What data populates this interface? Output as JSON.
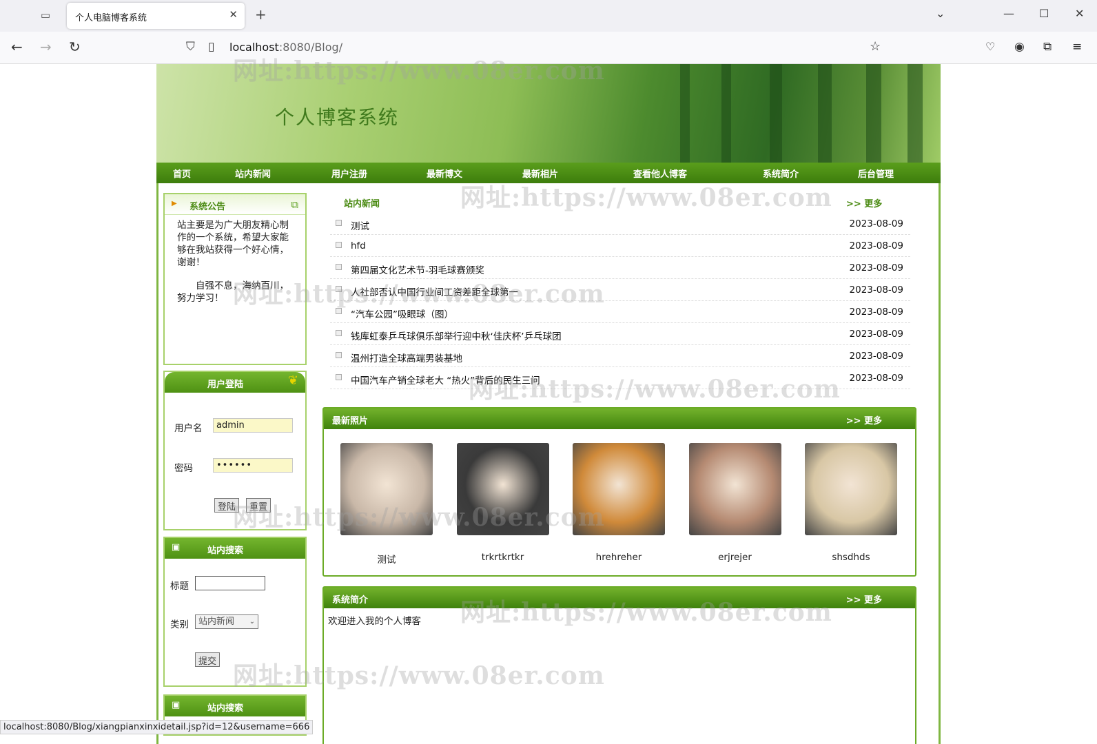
{
  "browser": {
    "tab_title": "个人电脑博客系统",
    "url_host": "localhost",
    "url_rest": ":8080/Blog/",
    "status_url": "localhost:8080/Blog/xiangpianxinxidetail.jsp?id=12&username=666"
  },
  "site": {
    "title": "个人博客系统",
    "menu": [
      "首页",
      "站内新闻",
      "用户注册",
      "最新博文",
      "最新相片",
      "查看他人博客",
      "系统简介",
      "后台管理"
    ]
  },
  "notice": {
    "title": "系统公告",
    "paragraph1": "站主要是为广大朋友精心制作的一个系统，希望大家能够在我站获得一个好心情，谢谢！",
    "paragraph2": "自强不息，海纳百川，努力学习！"
  },
  "login": {
    "title": "用户登陆",
    "username_label": "用户名",
    "username_value": "admin",
    "password_label": "密码",
    "password_value": "••••••",
    "login_button": "登陆",
    "reset_button": "重置"
  },
  "search": {
    "title": "站内搜索",
    "title_label": "标题",
    "title_value": "",
    "category_label": "类别",
    "category_value": "站内新闻",
    "submit_button": "提交",
    "title2": "站内搜索"
  },
  "news": {
    "title": "站内新闻",
    "more": ">> 更多",
    "items": [
      {
        "title": "测试",
        "date": "2023-08-09"
      },
      {
        "title": "hfd",
        "date": "2023-08-09"
      },
      {
        "title": "第四届文化艺术节-羽毛球赛颁奖",
        "date": "2023-08-09"
      },
      {
        "title": "人社部否认中国行业间工资差距全球第一",
        "date": "2023-08-09"
      },
      {
        "title": "“汽车公园”吸眼球（图）",
        "date": "2023-08-09"
      },
      {
        "title": "钱库虹泰乒乓球俱乐部举行迎中秋‘佳庆杯’乒乓球团",
        "date": "2023-08-09"
      },
      {
        "title": "温州打造全球高端男装基地",
        "date": "2023-08-09"
      },
      {
        "title": "中国汽车产销全球老大 “热火”背后的民生三问",
        "date": "2023-08-09"
      }
    ]
  },
  "photos": {
    "title": "最新照片",
    "more": ">> 更多",
    "items": [
      {
        "caption": "测试",
        "color": "#c9b8a8"
      },
      {
        "caption": "trkrtkrtkr",
        "color": "#3a3a3a"
      },
      {
        "caption": "hrehreher",
        "color": "#d08a3a"
      },
      {
        "caption": "erjrejer",
        "color": "#b58a72"
      },
      {
        "caption": "shsdhds",
        "color": "#d8c7a5"
      }
    ]
  },
  "intro": {
    "title": "系统简介",
    "more": ">> 更多",
    "text": "欢迎进入我的个人博客"
  },
  "watermark": "网址:https://www.08er.com"
}
